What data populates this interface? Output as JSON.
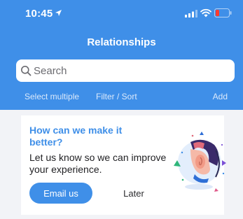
{
  "status_bar": {
    "time": "10:45",
    "icons": [
      "location-arrow-icon",
      "signal-icon",
      "wifi-icon",
      "battery-low-icon"
    ]
  },
  "header": {
    "title": "Relationships",
    "search": {
      "placeholder": "Search",
      "value": ""
    },
    "actions": {
      "select_multiple": "Select multiple",
      "filter_sort": "Filter / Sort",
      "add": "Add"
    }
  },
  "feedback_card": {
    "title": "How can we make it better?",
    "body": "Let us know so we can improve your experience.",
    "primary_button": "Email us",
    "secondary_button": "Later",
    "illustration_icon": "ear-listening-illustration"
  },
  "colors": {
    "brand_blue": "#3f8fe8",
    "background": "#f2f3f7",
    "card": "#ffffff",
    "battery_low": "#ff3b30"
  }
}
